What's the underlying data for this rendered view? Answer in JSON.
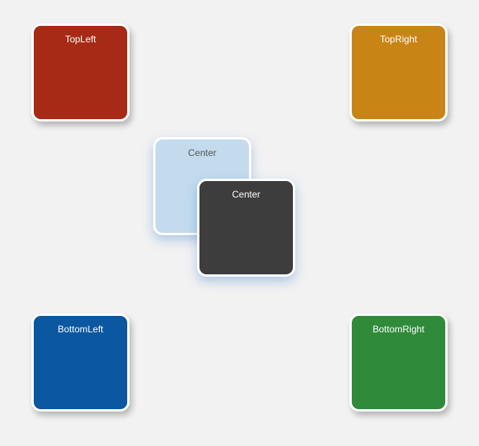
{
  "tiles": {
    "topleft": {
      "label": "TopLeft"
    },
    "topright": {
      "label": "TopRight"
    },
    "centerback": {
      "label": "Center"
    },
    "centerfront": {
      "label": "Center"
    },
    "bottomleft": {
      "label": "BottomLeft"
    },
    "bottomright": {
      "label": "BottomRight"
    }
  }
}
